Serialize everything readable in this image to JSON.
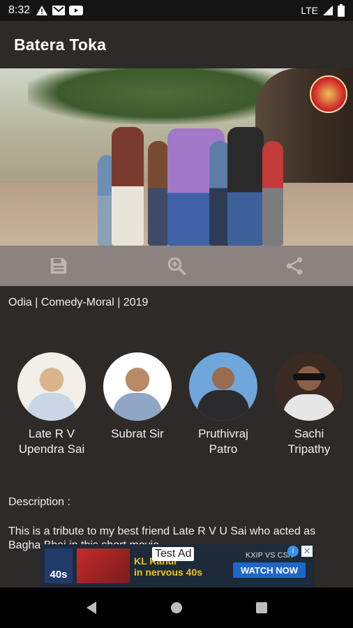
{
  "status_bar": {
    "time": "8:32",
    "network": "LTE"
  },
  "app_bar": {
    "title": "Batera Toka"
  },
  "meta": {
    "text": "Odia | Comedy-Moral | 2019"
  },
  "cast": [
    {
      "name": "Late R V\nUpendra Sai"
    },
    {
      "name": "Subrat Sir"
    },
    {
      "name": "Pruthivraj\nPatro"
    },
    {
      "name": "Sachi\nTripathy"
    }
  ],
  "description": {
    "label": "Description :",
    "text": "This is a tribute to my best friend Late R V U Sai who acted as Bagha Bhai in this short movie."
  },
  "ad": {
    "label": "Test Ad",
    "left_text": "40s",
    "headline_line1": "KL Rahul",
    "headline_line2": "in nervous 40s",
    "right_top": "KXIP VS CSK",
    "cta": "WATCH NOW"
  },
  "colors": {
    "background": "#2d2a28",
    "action_bar": "#8c8280",
    "status_bar": "#141414"
  }
}
